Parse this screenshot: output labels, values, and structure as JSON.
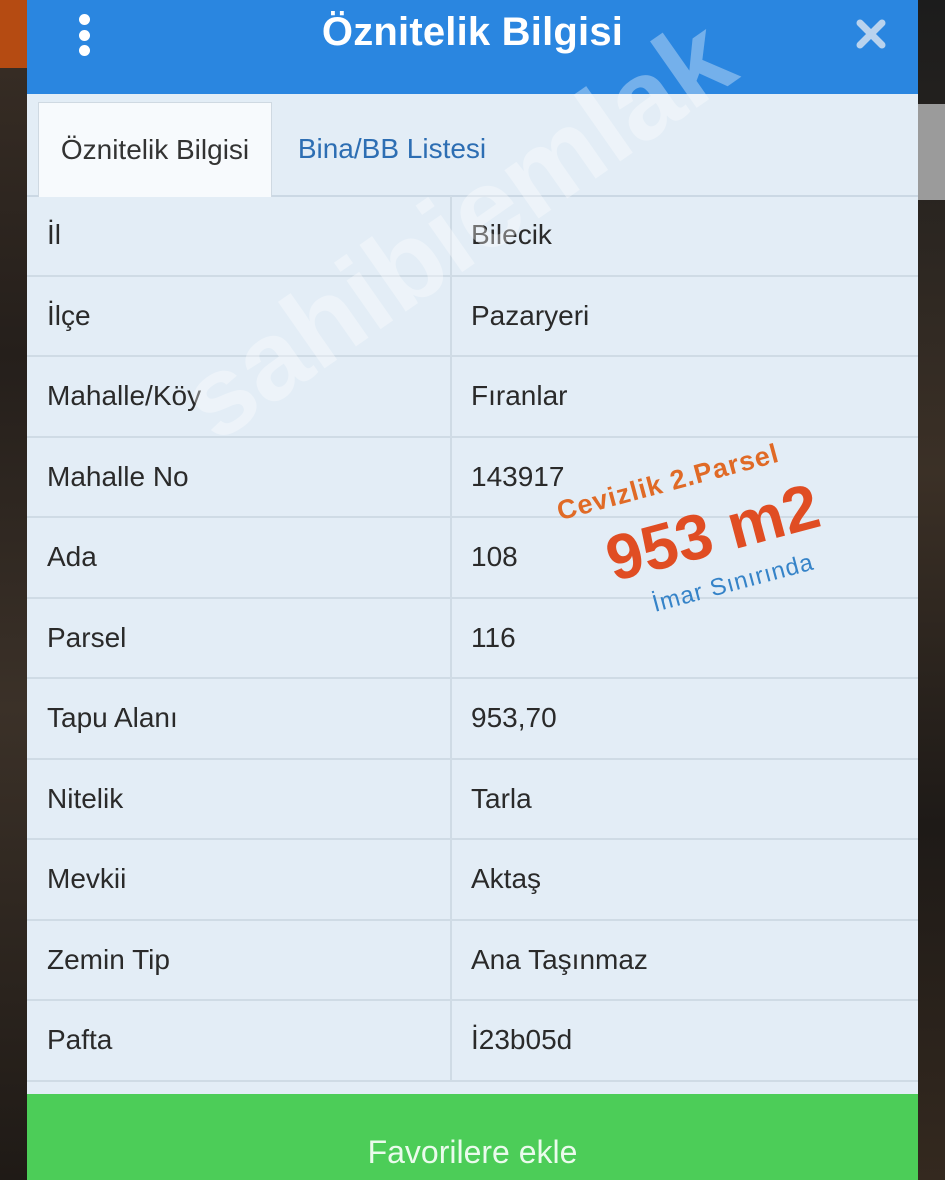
{
  "header": {
    "title": "Öznitelik Bilgisi",
    "menu_icon": "kebab-menu-icon",
    "close_icon": "close-icon",
    "color": "#2a86e0"
  },
  "tabs": [
    {
      "label": "Öznitelik Bilgisi",
      "active": true
    },
    {
      "label": "Bina/BB Listesi",
      "active": false
    }
  ],
  "rows": [
    {
      "label": "İl",
      "value": "Bilecik"
    },
    {
      "label": "İlçe",
      "value": "Pazaryeri"
    },
    {
      "label": "Mahalle/Köy",
      "value": "Fıranlar"
    },
    {
      "label": "Mahalle No",
      "value": "143917"
    },
    {
      "label": "Ada",
      "value": "108"
    },
    {
      "label": "Parsel",
      "value": "116"
    },
    {
      "label": "Tapu Alanı",
      "value": "953,70"
    },
    {
      "label": "Nitelik",
      "value": "Tarla"
    },
    {
      "label": "Mevkii",
      "value": "Aktaş"
    },
    {
      "label": "Zemin Tip",
      "value": "Ana Taşınmaz"
    },
    {
      "label": "Pafta",
      "value": "İ23b05d"
    }
  ],
  "overlay": {
    "line1": "Cevizlik 2.Parsel",
    "line2": "953 m2",
    "line3": "İmar Sınırında"
  },
  "watermark": "sahibiemlak",
  "footer": {
    "favorite_label": "Favorilere ekle",
    "color": "#4ccd58"
  }
}
